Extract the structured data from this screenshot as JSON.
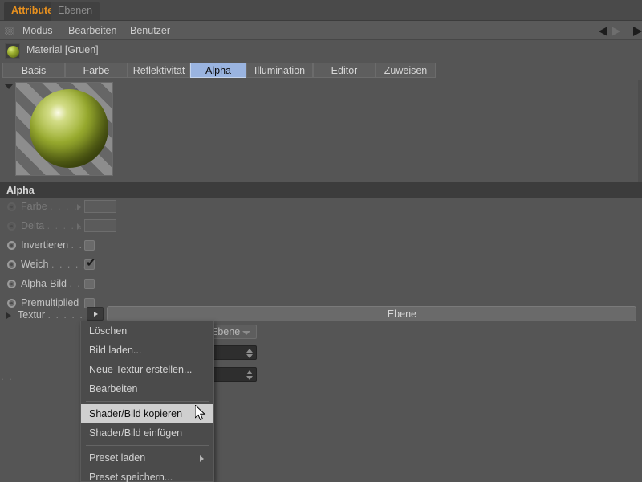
{
  "window": {
    "tabs": [
      {
        "label": "Attribute",
        "active": true
      },
      {
        "label": "Ebenen",
        "active": false
      }
    ]
  },
  "menubar": {
    "grip_icon": "grip-dots-icon",
    "items": [
      "Modus",
      "Bearbeiten",
      "Benutzer"
    ],
    "nav_prev_icon": "triangle-left-icon",
    "nav_next_icon": "triangle-right-icon"
  },
  "object_header": {
    "icon": "material-sphere-icon",
    "title": "Material [Gruen]"
  },
  "property_tabs": [
    {
      "label": "Basis",
      "selected": false
    },
    {
      "label": "Farbe",
      "selected": false
    },
    {
      "label": "Reflektivität",
      "selected": false
    },
    {
      "label": "Alpha",
      "selected": true
    },
    {
      "label": "Illumination",
      "selected": false
    },
    {
      "label": "Editor",
      "selected": false
    },
    {
      "label": "Zuweisen",
      "selected": false
    }
  ],
  "preview": {
    "collapse_icon": "triangle-down-icon",
    "swatch_icon": "material-preview-sphere"
  },
  "group": {
    "title": "Alpha"
  },
  "properties": [
    {
      "label": "Farbe",
      "dots": ". . . .",
      "widget": "color",
      "value": "",
      "disabled": true,
      "expander": true
    },
    {
      "label": "Delta",
      "dots": ". . . . .",
      "widget": "color",
      "value": "",
      "disabled": true,
      "expander": true
    },
    {
      "label": "Invertieren",
      "dots": ". .",
      "widget": "checkbox",
      "checked": false,
      "disabled": false
    },
    {
      "label": "Weich",
      "dots": ". . . . . .",
      "widget": "checkbox",
      "checked": true,
      "disabled": false
    },
    {
      "label": "Alpha-Bild",
      "dots": ". .",
      "widget": "checkbox",
      "checked": false,
      "disabled": false
    },
    {
      "label": "Premultiplied",
      "dots": "",
      "widget": "checkbox",
      "checked": false,
      "disabled": false
    }
  ],
  "texture_row": {
    "label": "Textur",
    "dots": ". . . . . .",
    "button_icon": "triangle-right-icon",
    "field_value": "Ebene"
  },
  "background_widgets": {
    "dropdown_value": "Ebene",
    "dropdown_icon": "chevron-down-icon",
    "spinner_icon": "spinner-up-down-icon",
    "ellipsis": ". ."
  },
  "context_menu": {
    "items": [
      {
        "label": "Löschen",
        "highlighted": false,
        "submenu": false,
        "separator_after": false
      },
      {
        "label": "Bild laden...",
        "highlighted": false,
        "submenu": false,
        "separator_after": false
      },
      {
        "label": "Neue Textur erstellen...",
        "highlighted": false,
        "submenu": false,
        "separator_after": false
      },
      {
        "label": "Bearbeiten",
        "highlighted": false,
        "submenu": false,
        "separator_after": true
      },
      {
        "label": "Shader/Bild kopieren",
        "highlighted": true,
        "submenu": false,
        "separator_after": false
      },
      {
        "label": "Shader/Bild einfügen",
        "highlighted": false,
        "submenu": false,
        "separator_after": true
      },
      {
        "label": "Preset laden",
        "highlighted": false,
        "submenu": true,
        "separator_after": false
      },
      {
        "label": "Preset speichern...",
        "highlighted": false,
        "submenu": false,
        "separator_after": false
      }
    ]
  },
  "cursor": {
    "icon": "mouse-pointer-icon"
  },
  "colors": {
    "accent_tab": "#e8911f",
    "selected_tab": "#9ab4e0",
    "panel_bg": "#555555",
    "menu_bg": "#4b4b4b",
    "highlight_bg": "#cfcfcf"
  }
}
